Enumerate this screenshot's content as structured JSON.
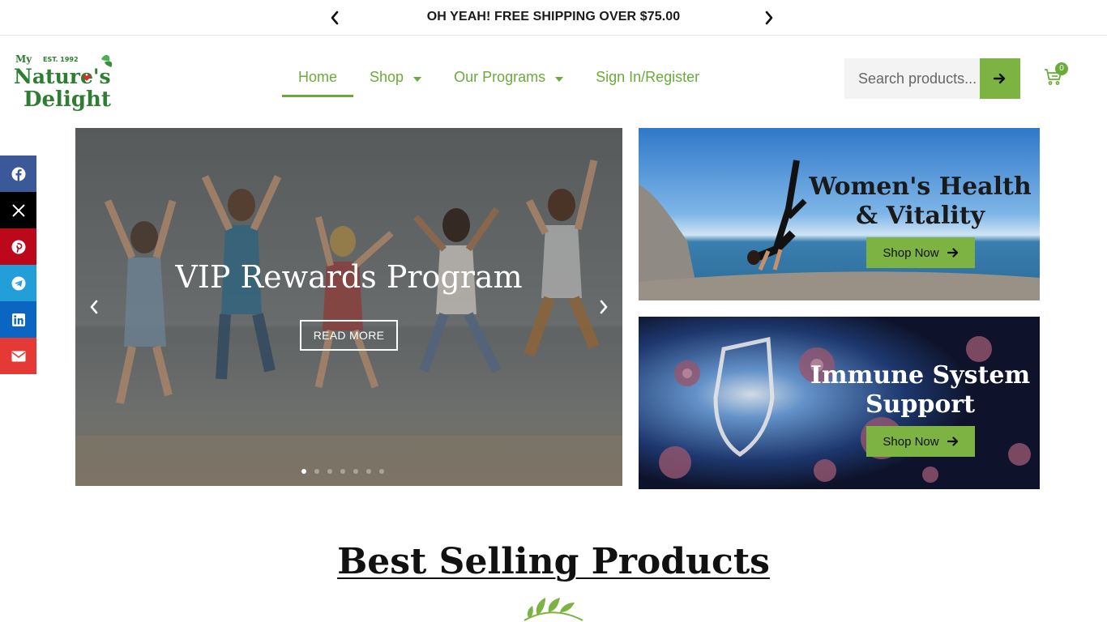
{
  "announcement": {
    "message": "OH YEAH! FREE SHIPPING OVER $75.00",
    "prev_icon": "chevron-left-icon",
    "next_icon": "chevron-right-icon"
  },
  "brand": {
    "logo_top": "My",
    "logo_est": "EST. 1992",
    "logo_line1": "Nature's",
    "logo_line2": "Delight",
    "green": "#6aab3a",
    "button_green": "#7cb342"
  },
  "nav": {
    "home": "Home",
    "shop": "Shop",
    "programs": "Our Programs",
    "signin": "Sign In/Register"
  },
  "search": {
    "placeholder": "Search products...",
    "button_icon": "arrow-right-icon"
  },
  "cart": {
    "count": "0",
    "icon": "cart-icon"
  },
  "social": [
    "facebook-icon",
    "x-icon",
    "pinterest-icon",
    "telegram-icon",
    "linkedin-icon",
    "email-icon"
  ],
  "hero": {
    "title": "VIP Rewards Program",
    "button": "READ MORE",
    "slide_count": 7,
    "active_slide": 1
  },
  "promos": [
    {
      "title": "Women's Health & Vitality",
      "button": "Shop Now"
    },
    {
      "title": "Immune System Support",
      "button": "Shop Now"
    }
  ],
  "section": {
    "title": "Best Selling Products"
  }
}
